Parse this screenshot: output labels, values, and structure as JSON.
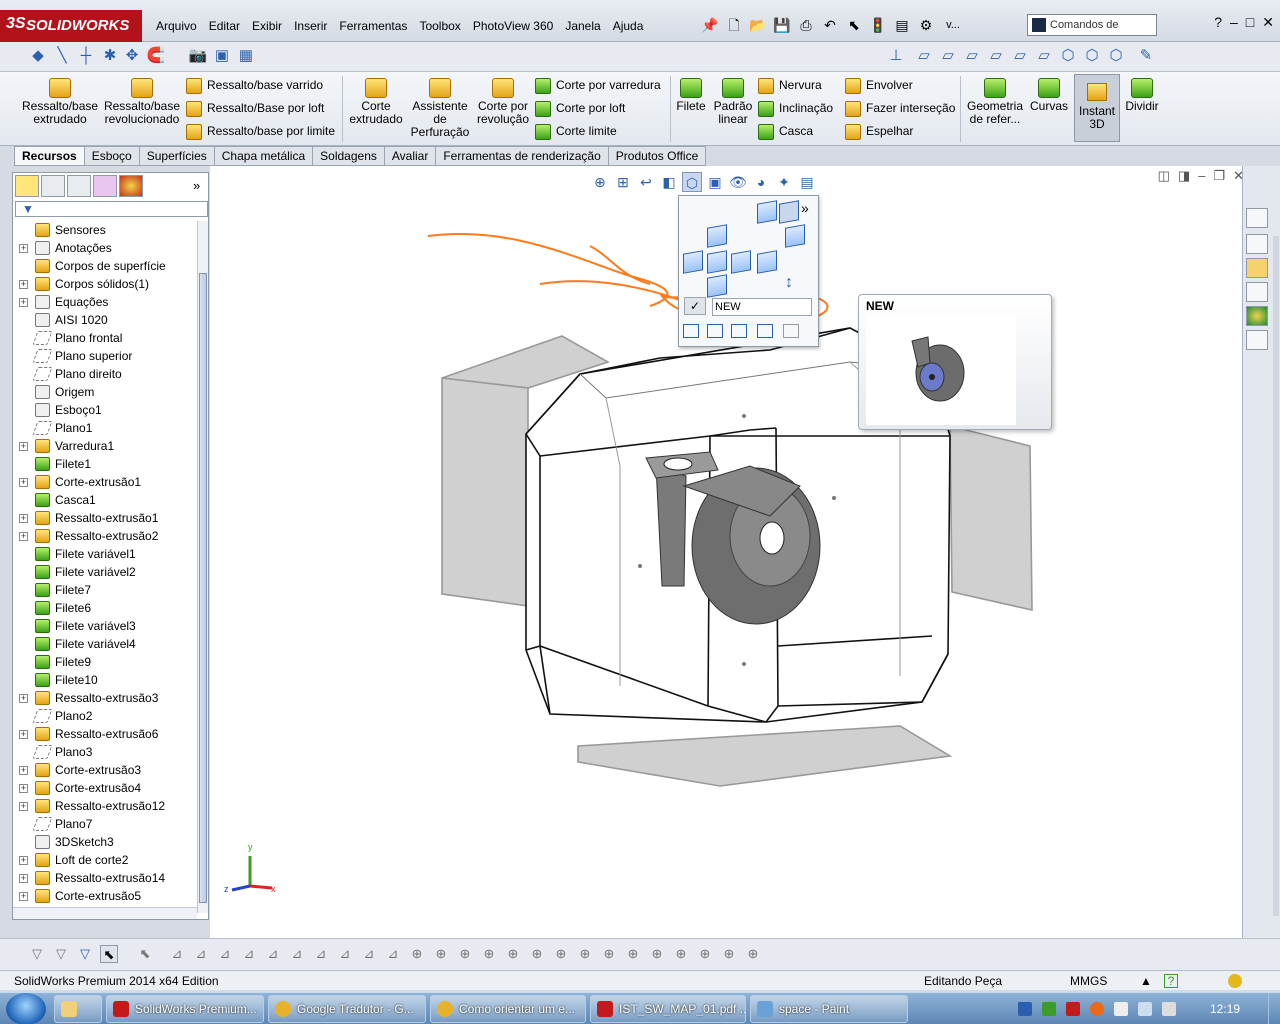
{
  "app": {
    "logo": "SOLIDWORKS",
    "logo_prefix": "3S"
  },
  "menu": [
    "Arquivo",
    "Editar",
    "Exibir",
    "Inserir",
    "Ferramentas",
    "Toolbox",
    "PhotoView 360",
    "Janela",
    "Ajuda"
  ],
  "search": {
    "placeholder": "Comandos de"
  },
  "toolbar_v": "v...",
  "ribbon": {
    "ressalto_extrudado": "Ressalto/base extrudado",
    "ressalto_revolucionado": "Ressalto/base revolucionado",
    "ressalto_varrido": "Ressalto/base varrido",
    "ressalto_loft": "Ressalto/Base por loft",
    "ressalto_limite": "Ressalto/base por limite",
    "corte_extrudado": "Corte extrudado",
    "assistente": "Assistente de Perfuração",
    "corte_revolucao": "Corte por revolução",
    "corte_varredura": "Corte por varredura",
    "corte_loft": "Corte por loft",
    "corte_limite": "Corte limite",
    "filete": "Filete",
    "padrao_linear": "Padrão linear",
    "nervura": "Nervura",
    "inclinacao": "Inclinação",
    "casca": "Casca",
    "envolver": "Envolver",
    "fazer_intersecao": "Fazer interseção",
    "espelhar": "Espelhar",
    "geometria": "Geometria de refer...",
    "curvas": "Curvas",
    "instant3d": "Instant 3D",
    "dividir": "Dividir"
  },
  "tabs": [
    "Recursos",
    "Esboço",
    "Superfícies",
    "Chapa metálica",
    "Soldagens",
    "Avaliar",
    "Ferramentas de renderização",
    "Produtos Office"
  ],
  "tree": [
    {
      "label": "Sensores",
      "exp": false,
      "icon": "sensor"
    },
    {
      "label": "Anotações",
      "exp": true,
      "icon": "annotation"
    },
    {
      "label": "Corpos de superfície",
      "exp": false,
      "icon": "surface"
    },
    {
      "label": "Corpos sólidos(1)",
      "exp": true,
      "icon": "solid"
    },
    {
      "label": "Equações",
      "exp": true,
      "icon": "equation"
    },
    {
      "label": "AISI 1020",
      "exp": false,
      "icon": "material"
    },
    {
      "label": "Plano frontal",
      "exp": false,
      "icon": "plane"
    },
    {
      "label": "Plano superior",
      "exp": false,
      "icon": "plane"
    },
    {
      "label": "Plano direito",
      "exp": false,
      "icon": "plane"
    },
    {
      "label": "Origem",
      "exp": false,
      "icon": "origin"
    },
    {
      "label": "Esboço1",
      "exp": false,
      "icon": "sketch"
    },
    {
      "label": "Plano1",
      "exp": false,
      "icon": "plane"
    },
    {
      "label": "Varredura1",
      "exp": true,
      "icon": "feature"
    },
    {
      "label": "Filete1",
      "exp": false,
      "icon": "fillet"
    },
    {
      "label": "Corte-extrusão1",
      "exp": true,
      "icon": "feature"
    },
    {
      "label": "Casca1",
      "exp": false,
      "icon": "fillet"
    },
    {
      "label": "Ressalto-extrusão1",
      "exp": true,
      "icon": "feature"
    },
    {
      "label": "Ressalto-extrusão2",
      "exp": true,
      "icon": "feature"
    },
    {
      "label": "Filete variável1",
      "exp": false,
      "icon": "fillet"
    },
    {
      "label": "Filete variável2",
      "exp": false,
      "icon": "fillet"
    },
    {
      "label": "Filete7",
      "exp": false,
      "icon": "fillet"
    },
    {
      "label": "Filete6",
      "exp": false,
      "icon": "fillet"
    },
    {
      "label": "Filete variável3",
      "exp": false,
      "icon": "fillet"
    },
    {
      "label": "Filete variável4",
      "exp": false,
      "icon": "fillet"
    },
    {
      "label": "Filete9",
      "exp": false,
      "icon": "fillet"
    },
    {
      "label": "Filete10",
      "exp": false,
      "icon": "fillet"
    },
    {
      "label": "Ressalto-extrusão3",
      "exp": true,
      "icon": "feature"
    },
    {
      "label": "Plano2",
      "exp": false,
      "icon": "plane"
    },
    {
      "label": "Ressalto-extrusão6",
      "exp": true,
      "icon": "feature"
    },
    {
      "label": "Plano3",
      "exp": false,
      "icon": "plane"
    },
    {
      "label": "Corte-extrusão3",
      "exp": true,
      "icon": "feature"
    },
    {
      "label": "Corte-extrusão4",
      "exp": true,
      "icon": "feature"
    },
    {
      "label": "Ressalto-extrusão12",
      "exp": true,
      "icon": "feature"
    },
    {
      "label": "Plano7",
      "exp": false,
      "icon": "plane"
    },
    {
      "label": "3DSketch3",
      "exp": false,
      "icon": "sketch"
    },
    {
      "label": "Loft de corte2",
      "exp": true,
      "icon": "feature"
    },
    {
      "label": "Ressalto-extrusão14",
      "exp": true,
      "icon": "feature"
    },
    {
      "label": "Corte-extrusão5",
      "exp": true,
      "icon": "feature"
    }
  ],
  "viewmenu": {
    "new_label": "NEW",
    "check": "✓"
  },
  "preview": {
    "title": "NEW"
  },
  "triad": {
    "x": "x",
    "y": "y",
    "z": "z"
  },
  "status": {
    "edition": "SolidWorks Premium 2014 x64 Edition",
    "mode": "Editando Peça",
    "units": "MMGS",
    "help": "?"
  },
  "taskbar": [
    {
      "label": "SolidWorks Premium...",
      "color": "#c31b1b"
    },
    {
      "label": "Google Tradutor - G...",
      "color": "#e8b12a"
    },
    {
      "label": "Como orientar um e...",
      "color": "#e8b12a"
    },
    {
      "label": "IST_SW_MAP_01.pdf ...",
      "color": "#c31b1b"
    },
    {
      "label": "space - Paint",
      "color": "#6aa2d8"
    }
  ],
  "clock": "12:19",
  "colors": {
    "accent": "#2b5fb0",
    "annotation": "#ff7a1a"
  }
}
